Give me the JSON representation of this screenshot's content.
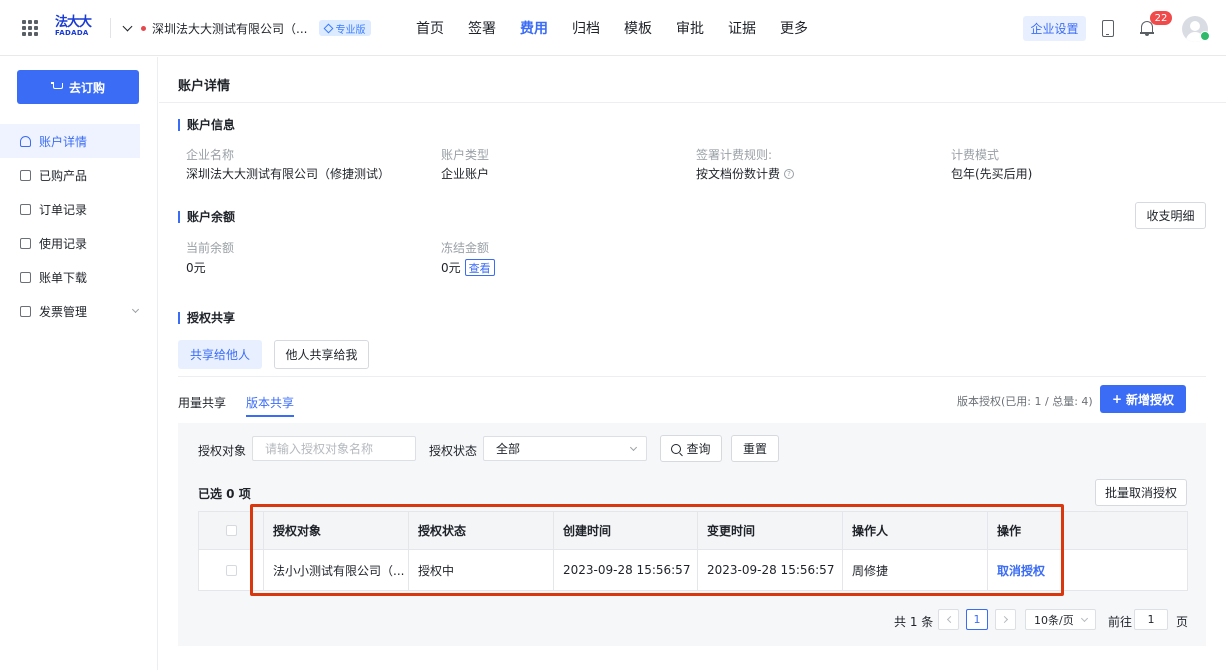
{
  "header": {
    "logo_cn": "法大大",
    "logo_en": "FADADA",
    "company": "深圳法大大测试有限公司（...",
    "edition_badge": "专业版",
    "nav": [
      "首页",
      "签署",
      "费用",
      "归档",
      "模板",
      "审批",
      "证据",
      "更多"
    ],
    "active_nav": "费用",
    "enterprise_settings": "企业设置",
    "notification_count": "22"
  },
  "sidebar": {
    "order_button": "去订购",
    "items": [
      "账户详情",
      "已购产品",
      "订单记录",
      "使用记录",
      "账单下载",
      "发票管理"
    ],
    "active_item": "账户详情"
  },
  "page": {
    "title": "账户详情",
    "account_info": {
      "section_title": "账户信息",
      "fields": [
        {
          "label": "企业名称",
          "value": "深圳法大大测试有限公司（修捷测试）"
        },
        {
          "label": "账户类型",
          "value": "企业账户"
        },
        {
          "label": "签署计费规则:",
          "value": "按文档份数计费"
        },
        {
          "label": "计费模式",
          "value": "包年(先买后用)"
        }
      ]
    },
    "balance": {
      "section_title": "账户余额",
      "statement_button": "收支明细",
      "current_label": "当前余额",
      "current_value": "0元",
      "frozen_label": "冻结金额",
      "frozen_value": "0元",
      "view_link": "查看"
    },
    "sharing": {
      "section_title": "授权共享",
      "segments": [
        "共享给他人",
        "他人共享给我"
      ],
      "tabs": [
        "用量共享",
        "版本共享"
      ],
      "active_tab": "版本共享",
      "quota_text": "版本授权(已用: 1 / 总量: 4)",
      "add_button": "新增授权",
      "filter": {
        "target_label": "授权对象",
        "target_placeholder": "请输入授权对象名称",
        "status_label": "授权状态",
        "status_value": "全部",
        "search_button": "查询",
        "reset_button": "重置"
      },
      "selected_text": "已选 0 项",
      "bulk_cancel_button": "批量取消授权",
      "table": {
        "columns": [
          "授权对象",
          "授权状态",
          "创建时间",
          "变更时间",
          "操作人",
          "操作"
        ],
        "rows": [
          {
            "target": "法小小测试有限公司（...",
            "status": "授权中",
            "created": "2023-09-28 15:56:57",
            "changed": "2023-09-28 15:56:57",
            "operator": "周修捷",
            "action": "取消授权"
          }
        ]
      },
      "pagination": {
        "total": "共 1 条",
        "current_page": "1",
        "page_size": "10条/页",
        "goto_label": "前往",
        "goto_value": "1",
        "page_suffix": "页"
      }
    }
  },
  "colors": {
    "primary": "#3b6cf6",
    "highlight": "#d9380e",
    "badge": "#f04a4a"
  }
}
